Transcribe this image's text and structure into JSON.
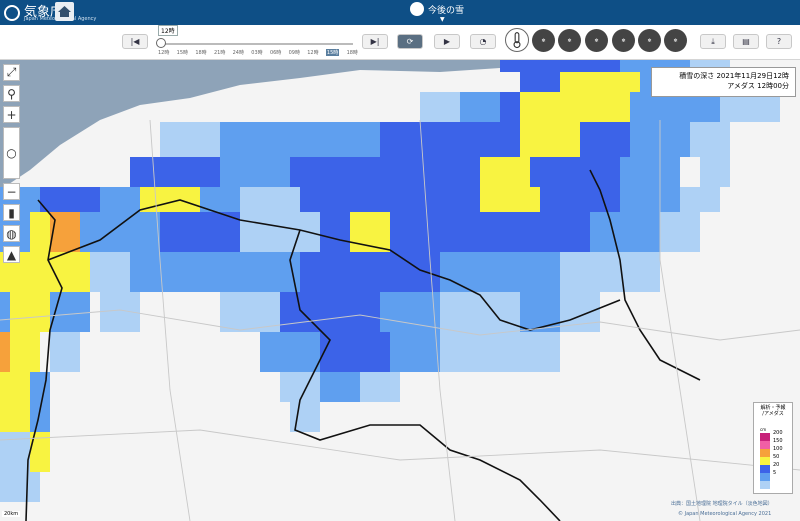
{
  "header": {
    "logo_text": "気象庁",
    "logo_sub": "Japan Meteorological Agency",
    "page_title": "今後の雪"
  },
  "toolbar": {
    "time_label": "12時",
    "time_ticks": [
      "12時",
      "15時",
      "18時",
      "21時",
      "24時",
      "03時",
      "06時",
      "09時",
      "12時",
      "15時",
      "18時"
    ],
    "highlight_index": 9
  },
  "map": {
    "title": "積雪の深さ",
    "datetime": "2021年11月29日12時",
    "source": "アメダス",
    "source_time": "12時00分"
  },
  "legend": {
    "title": "解析・予報\n/アメダス",
    "unit": "cm",
    "levels": [
      {
        "label": "200",
        "color": "#c7227a"
      },
      {
        "label": "150",
        "color": "#f15fa5"
      },
      {
        "label": "100",
        "color": "#f6a13b"
      },
      {
        "label": "50",
        "color": "#f8f341"
      },
      {
        "label": "20",
        "color": "#3c63e8"
      },
      {
        "label": "5",
        "color": "#5f9fef"
      },
      {
        "label": "",
        "color": "#aed1f5"
      }
    ]
  },
  "attribution": {
    "line1": "出典：国土地理院 地理院タイル（淡色地図）",
    "line2": "© Japan Meteorological Agency 2021"
  },
  "scale_label": "20km",
  "colors": {
    "header_bg": "#0e4f86",
    "sea": "#8ea3b8",
    "land": "#f3f3f3"
  }
}
